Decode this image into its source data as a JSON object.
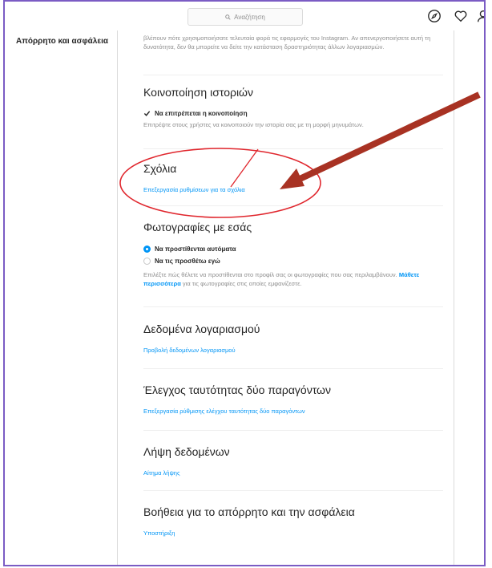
{
  "search": {
    "placeholder": "Αναζήτηση"
  },
  "sidebar": {
    "active_item": "Απόρρητο και ασφάλεια"
  },
  "activity_text": "βλέπουν πότε χρησιμοποιήσατε τελευταία φορά τις εφαρμογές του Instagram. Αν απενεργοποιήσετε αυτή τη δυνατότητα, δεν θα μπορείτε να δείτε την κατάσταση δραστηριότητας άλλων λογαριασμών.",
  "story_sharing": {
    "title": "Κοινοποίηση ιστοριών",
    "option": "Να επιτρέπεται η κοινοποίηση",
    "option_checked": true,
    "help": "Επιτρέψτε στους χρήστες να κοινοποιούν την ιστορία σας με τη μορφή μηνυμάτων."
  },
  "comments": {
    "title": "Σχόλια",
    "link": "Επεξεργασία ρυθμίσεων για τα σχόλια"
  },
  "photos_of_you": {
    "title": "Φωτογραφίες με εσάς",
    "options": [
      "Να προστίθενται αυτόματα",
      "Να τις προσθέτω εγώ"
    ],
    "selected_index": 0,
    "help_before": "Επιλέξτε πώς θέλετε να προστίθενται στο προφίλ σας οι φωτογραφίες που σας περιλαμβάνουν.",
    "help_link": "Μάθετε περισσότερα",
    "help_after": "για τις φωτογραφίες στις οποίες εμφανίζεστε."
  },
  "account_data": {
    "title": "Δεδομένα λογαριασμού",
    "link": "Προβολή δεδομένων λογαριασμού"
  },
  "two_factor": {
    "title": "Έλεγχος ταυτότητας δύο παραγόντων",
    "link": "Επεξεργασία ρύθμισης ελέγχου ταυτότητας δύο παραγόντων"
  },
  "data_download": {
    "title": "Λήψη δεδομένων",
    "link": "Αίτημα λήψης"
  },
  "privacy_help": {
    "title": "Βοήθεια για το απόρρητο και την ασφάλεια",
    "link": "Υποστήριξη"
  },
  "colors": {
    "accent": "#0095f6",
    "annotation": "#e0262d",
    "arrow": "#a83223",
    "frame": "#7b5cc4"
  }
}
